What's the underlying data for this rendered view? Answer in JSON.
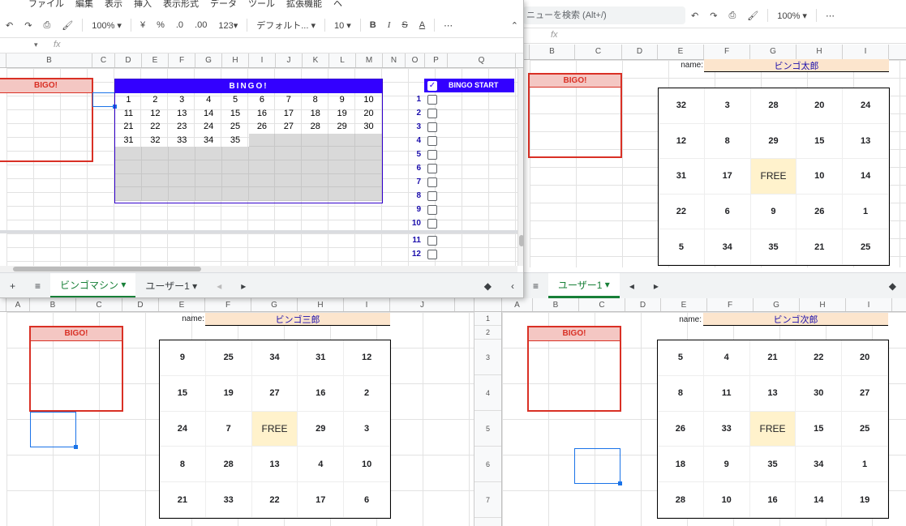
{
  "machine_window": {
    "menu": [
      "ファイル",
      "編集",
      "表示",
      "挿入",
      "表示形式",
      "データ",
      "ツール",
      "拡張機能",
      "ヘ"
    ],
    "zoom": "100%",
    "currency": "¥",
    "percent": "%",
    "dec_less": ".0",
    "dec_more": ".00",
    "num_format": "123",
    "font": "デフォルト...",
    "font_size": "10",
    "fx": "fx",
    "columns": [
      "B",
      "C",
      "D",
      "E",
      "F",
      "G",
      "H",
      "I",
      "J",
      "K",
      "L",
      "M",
      "N",
      "O",
      "P",
      "Q"
    ],
    "bingo_label": "BIGO!",
    "machine_title": "BINGO!",
    "drawn_numbers": [
      "1",
      "2",
      "3",
      "4",
      "5",
      "6",
      "7",
      "8",
      "9",
      "10",
      "11",
      "12",
      "13",
      "14",
      "15",
      "16",
      "17",
      "18",
      "19",
      "20",
      "21",
      "22",
      "23",
      "24",
      "25",
      "26",
      "27",
      "28",
      "29",
      "30",
      "31",
      "32",
      "33",
      "34",
      "35"
    ],
    "start_label": "BINGO START",
    "rounds": [
      "1",
      "2",
      "3",
      "4",
      "5",
      "6",
      "7",
      "8",
      "9",
      "10",
      "11",
      "12"
    ],
    "tabs": [
      "ビンゴマシン",
      "ユーザー1"
    ]
  },
  "user1_window": {
    "search_placeholder": "ニューを検索 (Alt+/)",
    "zoom": "100%",
    "fx": "fx",
    "columns": [
      "B",
      "C",
      "D",
      "E",
      "F",
      "G",
      "H",
      "I"
    ],
    "bingo_label": "BIGO!",
    "name_label": "name:",
    "name_value": "ビンゴ太郎",
    "card": [
      "32",
      "3",
      "28",
      "20",
      "24",
      "12",
      "8",
      "29",
      "15",
      "13",
      "31",
      "17",
      "FREE",
      "10",
      "14",
      "22",
      "6",
      "9",
      "26",
      "1",
      "5",
      "34",
      "35",
      "21",
      "25"
    ],
    "tab": "ユーザー1"
  },
  "user3_window": {
    "columns": [
      "A",
      "B",
      "C",
      "D",
      "E",
      "F",
      "G",
      "H",
      "I",
      "J"
    ],
    "bingo_label": "BIGO!",
    "name_label": "name:",
    "name_value": "ビンゴ三郎",
    "card": [
      "9",
      "25",
      "34",
      "31",
      "12",
      "15",
      "19",
      "27",
      "16",
      "2",
      "24",
      "7",
      "FREE",
      "29",
      "3",
      "8",
      "28",
      "13",
      "4",
      "10",
      "21",
      "33",
      "22",
      "17",
      "6"
    ]
  },
  "user2_window": {
    "columns": [
      "A",
      "B",
      "C",
      "D",
      "E",
      "F",
      "G",
      "H",
      "I"
    ],
    "rows": [
      "1",
      "2",
      "3",
      "4",
      "5",
      "6",
      "7"
    ],
    "bingo_label": "BIGO!",
    "name_label": "name:",
    "name_value": "ビンゴ次郎",
    "card": [
      "5",
      "4",
      "21",
      "22",
      "20",
      "8",
      "11",
      "13",
      "30",
      "27",
      "26",
      "33",
      "FREE",
      "15",
      "25",
      "18",
      "9",
      "35",
      "34",
      "1",
      "28",
      "10",
      "16",
      "14",
      "19"
    ]
  }
}
